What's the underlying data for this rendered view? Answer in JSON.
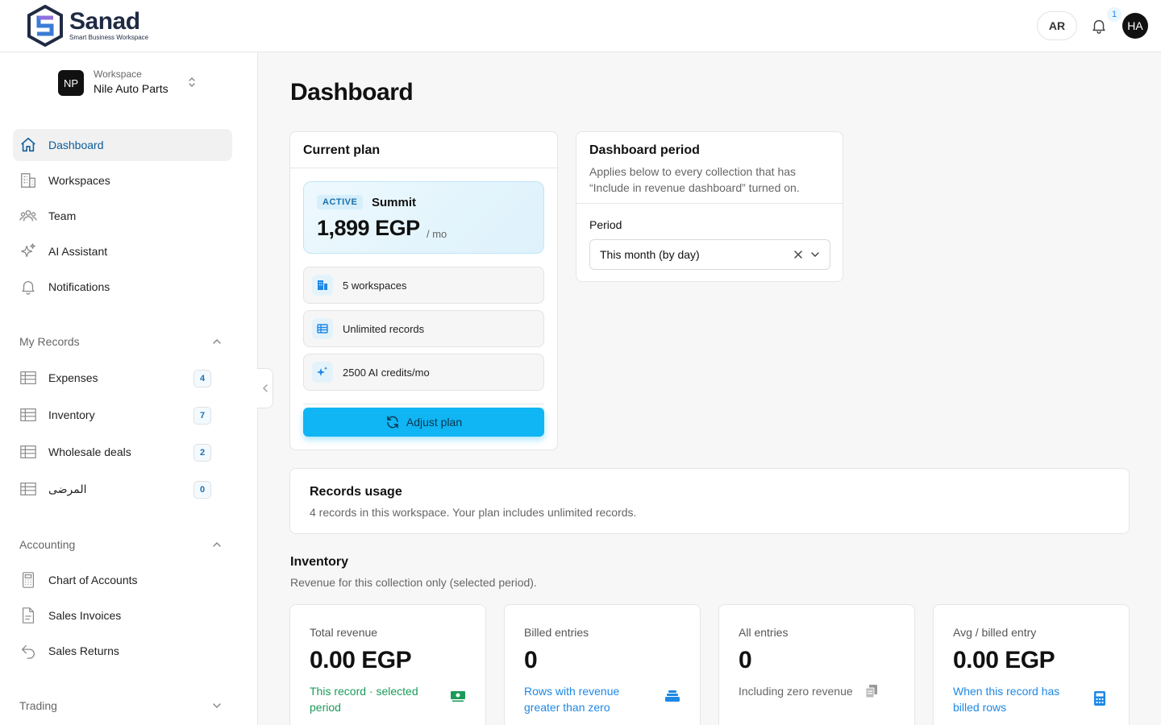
{
  "brand": {
    "name": "Sanad",
    "tagline": "Smart Business Workspace"
  },
  "header": {
    "language_button": "AR",
    "notification_count": "1",
    "user_initials": "HA"
  },
  "workspace": {
    "badge": "NP",
    "label": "Workspace",
    "name": "Nile Auto Parts"
  },
  "nav": {
    "main": [
      {
        "label": "Dashboard",
        "icon": "home-icon",
        "active": true
      },
      {
        "label": "Workspaces",
        "icon": "building-icon"
      },
      {
        "label": "Team",
        "icon": "team-icon"
      },
      {
        "label": "AI Assistant",
        "icon": "sparkles-icon"
      },
      {
        "label": "Notifications",
        "icon": "bell-icon"
      }
    ],
    "my_records": {
      "title": "My Records",
      "items": [
        {
          "label": "Expenses",
          "count": "4"
        },
        {
          "label": "Inventory",
          "count": "7"
        },
        {
          "label": "Wholesale deals",
          "count": "2"
        },
        {
          "label": "المرضى",
          "count": "0"
        }
      ]
    },
    "accounting": {
      "title": "Accounting",
      "items": [
        {
          "label": "Chart of Accounts",
          "icon": "calculator-icon"
        },
        {
          "label": "Sales Invoices",
          "icon": "document-icon"
        },
        {
          "label": "Sales Returns",
          "icon": "return-arrow-icon"
        }
      ]
    },
    "trading": {
      "title": "Trading"
    }
  },
  "page": {
    "title": "Dashboard"
  },
  "current_plan": {
    "title": "Current plan",
    "status": "ACTIVE",
    "plan_name": "Summit",
    "price": "1,899 EGP",
    "period": "/ mo",
    "features": [
      "5 workspaces",
      "Unlimited records",
      "2500 AI credits/mo"
    ],
    "adjust_button": "Adjust plan"
  },
  "dashboard_period": {
    "title": "Dashboard period",
    "description": "Applies below to every collection that has “Include in revenue dashboard” turned on.",
    "period_label": "Period",
    "period_value": "This month (by day)"
  },
  "records_usage": {
    "title": "Records usage",
    "text": "4 records in this workspace. Your plan includes unlimited records."
  },
  "inventory_section": {
    "title": "Inventory",
    "subtitle": "Revenue for this collection only (selected period).",
    "stats": [
      {
        "label": "Total revenue",
        "value": "0.00 EGP",
        "sub": "This record · selected period",
        "color": "#1a9b5a",
        "icon": "cash-icon"
      },
      {
        "label": "Billed entries",
        "value": "0",
        "sub": "Rows with revenue greater than zero",
        "color": "#1e88e5",
        "icon": "stack-icon"
      },
      {
        "label": "All entries",
        "value": "0",
        "sub": "Including zero revenue",
        "color": "#666666",
        "icon": "copy-icon"
      },
      {
        "label": "Avg / billed entry",
        "value": "0.00 EGP",
        "sub": "When this record has billed rows",
        "color": "#1e88e5",
        "icon": "calculator-icon"
      }
    ]
  },
  "colors": {
    "accent": "#10b5f3",
    "active_nav": "#0b5e9c",
    "brand": "#1f2a44"
  }
}
